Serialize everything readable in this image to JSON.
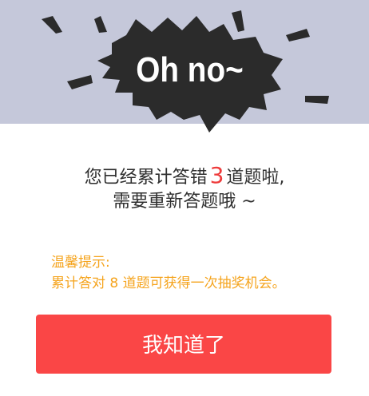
{
  "header": {
    "burst_text": "Oh no~"
  },
  "message": {
    "line1_prefix": "您已经累计答错",
    "wrong_count": "3",
    "line1_suffix": "道题啦,",
    "line2": "需要重新答题哦 ~"
  },
  "tip": {
    "title": "温馨提示:",
    "body": "累计答对 8 道题可获得一次抽奖机会。"
  },
  "actions": {
    "confirm_label": "我知道了"
  },
  "colors": {
    "banner_bg": "#c5c8da",
    "burst_fill": "#2b2b2b",
    "accent_red": "#fa4646",
    "count_red": "#ee3b3b",
    "tip_orange": "#f5a41e"
  }
}
